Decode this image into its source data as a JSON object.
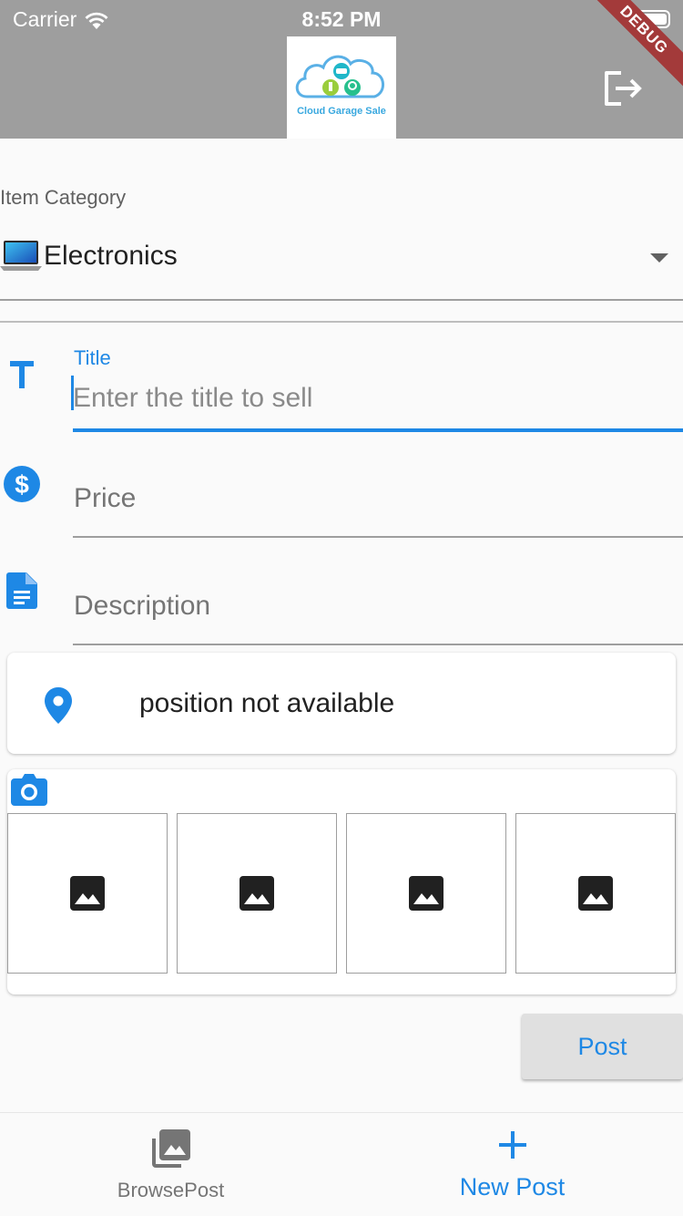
{
  "status_bar": {
    "carrier": "Carrier",
    "time": "8:52 PM"
  },
  "app_bar": {
    "logo_text": "Cloud Garage Sale",
    "debug_banner": "DEBUG",
    "logout_icon": "logout-icon"
  },
  "category": {
    "label": "Item Category",
    "selected_value": "Electronics",
    "selected_icon": "laptop-icon"
  },
  "fields": {
    "title": {
      "label": "Title",
      "placeholder": "Enter the title to sell",
      "icon": "text-title-icon"
    },
    "price": {
      "placeholder": "Price",
      "icon": "dollar-icon"
    },
    "description": {
      "placeholder": "Description",
      "icon": "document-icon"
    }
  },
  "location": {
    "text": "position not available",
    "icon": "location-pin-icon"
  },
  "photos": {
    "camera_icon": "camera-icon",
    "slot_icon": "image-placeholder-icon"
  },
  "actions": {
    "post_label": "Post"
  },
  "bottom_nav": {
    "items": [
      {
        "label": "BrowsePost",
        "icon": "photo-library-icon",
        "active": false
      },
      {
        "label": "New Post",
        "icon": "add-icon",
        "active": true
      }
    ]
  },
  "colors": {
    "accent": "#1e88e5",
    "app_bar": "#9e9e9e",
    "debug_ribbon": "#a33a3a"
  }
}
